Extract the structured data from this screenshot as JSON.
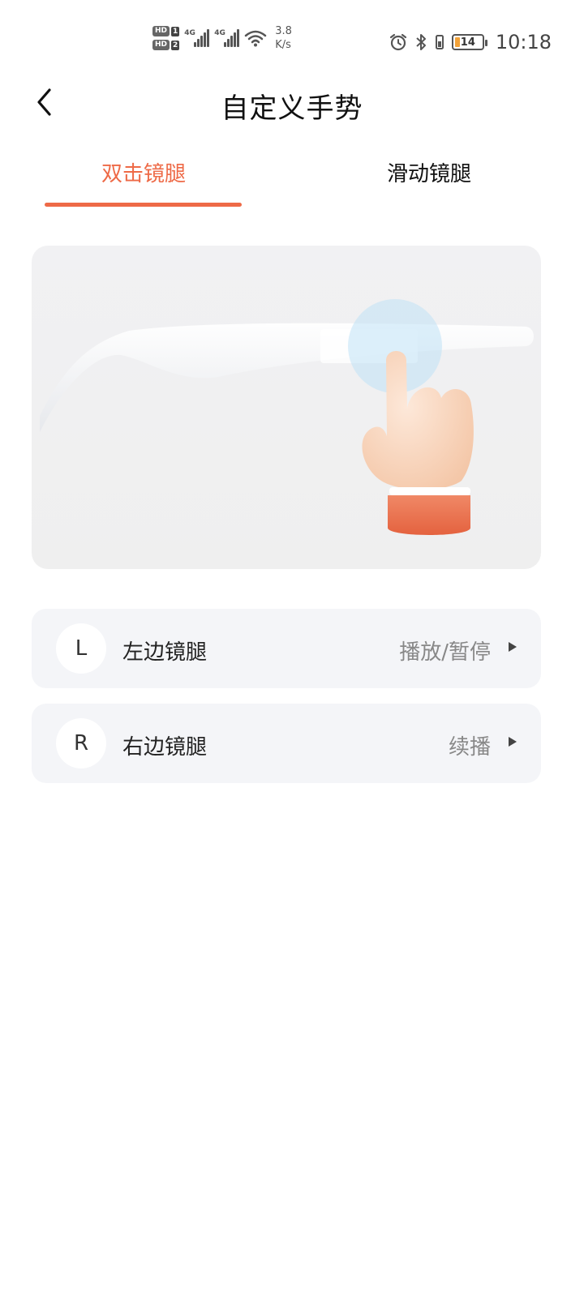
{
  "status_bar": {
    "sim1": "HD",
    "sim1_num": "1",
    "sim2": "HD",
    "sim2_num": "2",
    "net1": "4G",
    "net2": "4G",
    "speed_value": "3.8",
    "speed_unit": "K/s",
    "battery_level": "14",
    "time": "10:18",
    "icons": [
      "alarm-icon",
      "bluetooth-icon",
      "vibrate-icon",
      "battery-icon"
    ]
  },
  "header": {
    "title": "自定义手势"
  },
  "tabs": [
    {
      "label": "双击镜腿",
      "active": true
    },
    {
      "label": "滑动镜腿",
      "active": false
    }
  ],
  "colors": {
    "accent": "#ee6a47",
    "row_bg": "#f4f5f8"
  },
  "settings": [
    {
      "badge": "L",
      "label": "左边镜腿",
      "value": "播放/暂停"
    },
    {
      "badge": "R",
      "label": "右边镜腿",
      "value": "续播"
    }
  ]
}
